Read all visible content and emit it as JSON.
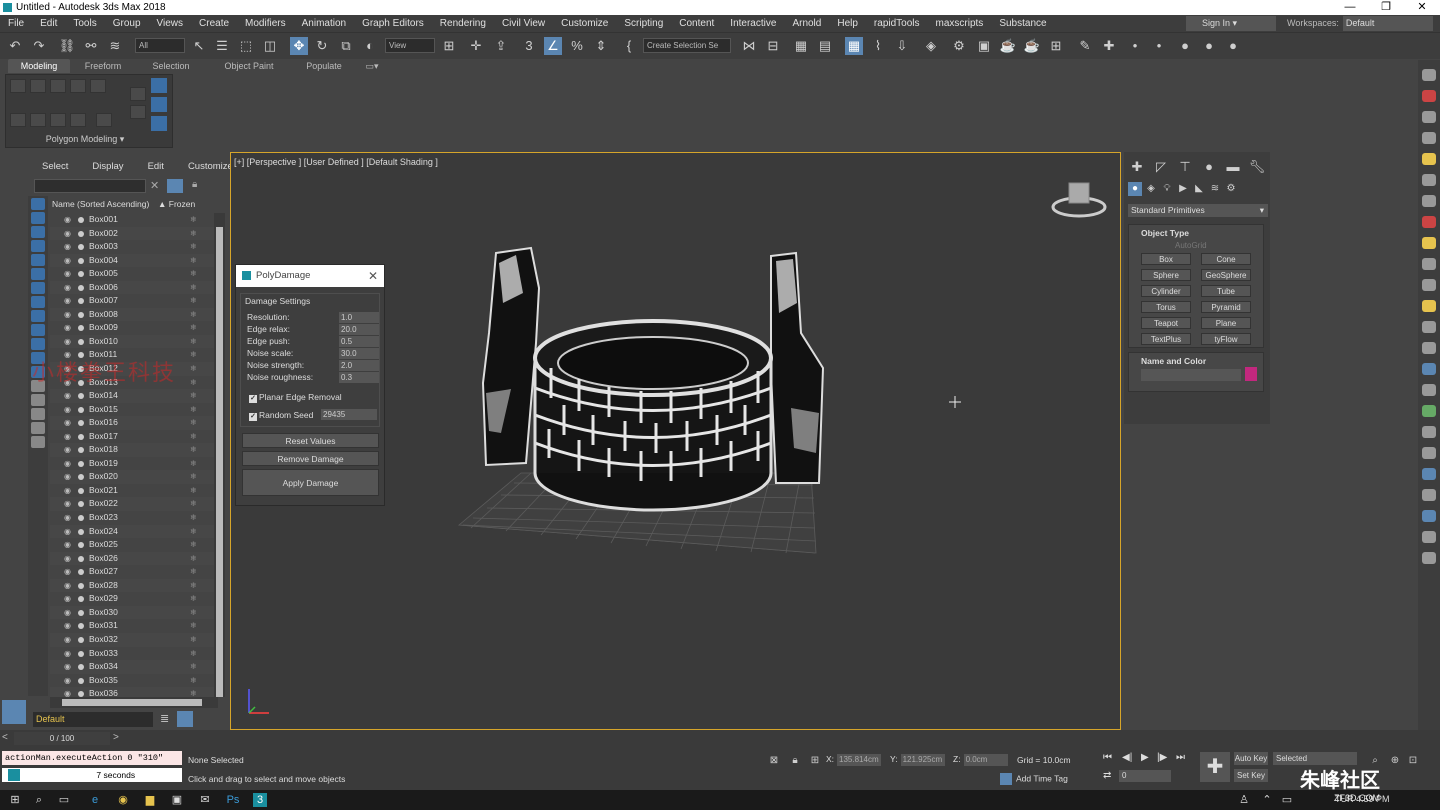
{
  "window": {
    "title": "Untitled - Autodesk 3ds Max 2018",
    "min": "—",
    "restore": "❐",
    "close": "✕"
  },
  "menu": [
    "File",
    "Edit",
    "Tools",
    "Group",
    "Views",
    "Create",
    "Modifiers",
    "Animation",
    "Graph Editors",
    "Rendering",
    "Civil View",
    "Customize",
    "Scripting",
    "Content",
    "Interactive",
    "Arnold",
    "Help",
    "rapidTools",
    "maxscripts",
    "Substance"
  ],
  "account": {
    "signin": "Sign In",
    "workspaces_label": "Workspaces:",
    "workspaces_value": "Default"
  },
  "toolbar": {
    "filter": "All",
    "refcoord": "View",
    "selset": "Create Selection Se"
  },
  "ribbon": {
    "tabs": [
      "Modeling",
      "Freeform",
      "Selection",
      "Object Paint",
      "Populate"
    ],
    "active": "Modeling",
    "panel_label": "Polygon Modeling ▾"
  },
  "scene": {
    "menu": [
      "Select",
      "Display",
      "Edit",
      "Customize"
    ],
    "col_name": "Name (Sorted Ascending)",
    "col_frozen": "▲ Frozen",
    "items": [
      "Box001",
      "Box002",
      "Box003",
      "Box004",
      "Box005",
      "Box006",
      "Box007",
      "Box008",
      "Box009",
      "Box010",
      "Box011",
      "Box012",
      "Box013",
      "Box014",
      "Box015",
      "Box016",
      "Box017",
      "Box018",
      "Box019",
      "Box020",
      "Box021",
      "Box022",
      "Box023",
      "Box024",
      "Box025",
      "Box026",
      "Box027",
      "Box028",
      "Box029",
      "Box030",
      "Box031",
      "Box032",
      "Box033",
      "Box034",
      "Box035",
      "Box036"
    ],
    "layer": "Default",
    "watermark": "小楼拳王科技"
  },
  "viewport": {
    "label": "[+] [Perspective ] [User Defined ] [Default Shading ]"
  },
  "polydamage": {
    "title": "PolyDamage",
    "group": "Damage Settings",
    "params": [
      {
        "label": "Resolution:",
        "value": "1.0"
      },
      {
        "label": "Edge relax:",
        "value": "20.0"
      },
      {
        "label": "Edge push:",
        "value": "0.5"
      },
      {
        "label": "Noise scale:",
        "value": "30.0"
      },
      {
        "label": "Noise strength:",
        "value": "2.0"
      },
      {
        "label": "Noise roughness:",
        "value": "0.3"
      }
    ],
    "planar": "Planar Edge Removal",
    "seed_label": "Random Seed",
    "seed_value": "29435",
    "reset": "Reset Values",
    "remove": "Remove Damage",
    "apply": "Apply Damage"
  },
  "command": {
    "dropdown": "Standard Primitives",
    "object_type": "Object Type",
    "autogrid": "AutoGrid",
    "buttons": [
      "Box",
      "Cone",
      "Sphere",
      "GeoSphere",
      "Cylinder",
      "Tube",
      "Torus",
      "Pyramid",
      "Teapot",
      "Plane",
      "TextPlus",
      "tyFlow"
    ],
    "name_color": "Name and Color",
    "swatch_color": "#c2287e"
  },
  "status": {
    "time": "0 / 100",
    "script": "actionMan.executeAction 0 \"310\"",
    "script2": "7 seconds",
    "selection": "None Selected",
    "prompt": "Click and drag to select and move objects",
    "x": "135.814cm",
    "y": "121.925cm",
    "z": "0.0cm",
    "grid": "Grid = 10.0cm",
    "addtime": "Add Time Tag",
    "frame": "0",
    "autokey": "Auto Key",
    "setkey": "Set Key",
    "selected": "Selected"
  },
  "taskbar": {
    "clock": "4:59 PM",
    "lang": "TUR"
  },
  "watermark": {
    "brand": "朱峰社区",
    "url": "ZF3D.COM"
  }
}
